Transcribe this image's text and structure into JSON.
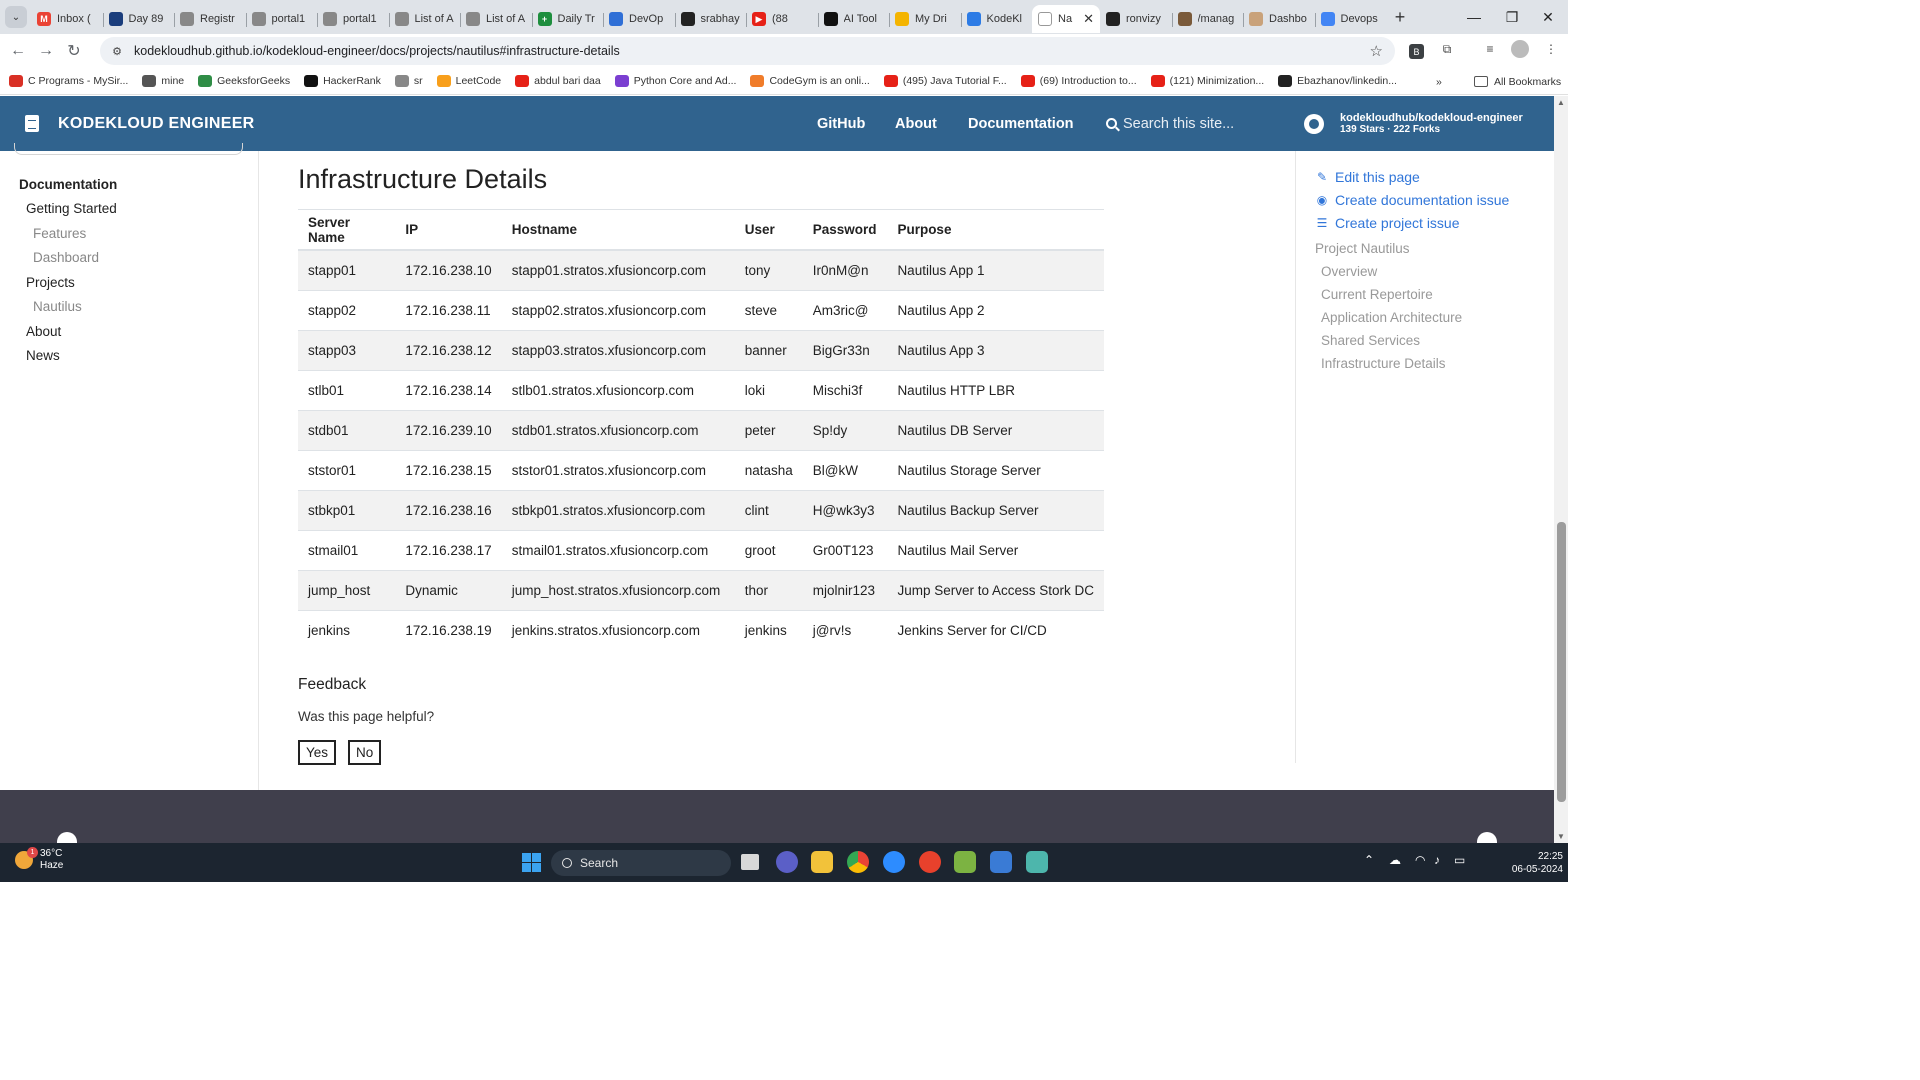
{
  "browser": {
    "tabs": [
      {
        "label": "Inbox (",
        "fav": "gmail-icon",
        "color": "#ea4335",
        "glyph": "M"
      },
      {
        "label": "Day 89",
        "fav": "page-icon",
        "color": "#1a3d7c",
        "glyph": ""
      },
      {
        "label": "Registr",
        "fav": "loading-icon",
        "color": "#888888",
        "glyph": ""
      },
      {
        "label": "portal1",
        "fav": "loading-icon",
        "color": "#888888",
        "glyph": ""
      },
      {
        "label": "portal1",
        "fav": "loading-icon",
        "color": "#888888",
        "glyph": ""
      },
      {
        "label": "List of A",
        "fav": "loading-icon",
        "color": "#888888",
        "glyph": ""
      },
      {
        "label": "List of A",
        "fav": "loading-icon",
        "color": "#888888",
        "glyph": ""
      },
      {
        "label": "Daily Tr",
        "fav": "sheets-icon",
        "color": "#1e8e3e",
        "glyph": "+"
      },
      {
        "label": "DevOp",
        "fav": "devops-icon",
        "color": "#2f6fd6",
        "glyph": ""
      },
      {
        "label": "srabhay",
        "fav": "github-icon",
        "color": "#222222",
        "glyph": ""
      },
      {
        "label": "(88",
        "fav": "youtube-icon",
        "color": "#e62117",
        "glyph": "▶"
      },
      {
        "label": "AI Tool",
        "fav": "ai-tool-icon",
        "color": "#111111",
        "glyph": ""
      },
      {
        "label": "My Dri",
        "fav": "drive-icon",
        "color": "#f4b400",
        "glyph": ""
      },
      {
        "label": "KodeKl",
        "fav": "kodekloud-icon",
        "color": "#2c7be5",
        "glyph": ""
      },
      {
        "label": "Na",
        "fav": "page-icon",
        "color": "#ffffff",
        "glyph": "",
        "active": true
      },
      {
        "label": "ronvizy",
        "fav": "github-icon",
        "color": "#222222",
        "glyph": ""
      },
      {
        "label": "/manag",
        "fav": "image-icon",
        "color": "#7a5a3a",
        "glyph": ""
      },
      {
        "label": "Dashbo",
        "fav": "avatar-icon",
        "color": "#c9a27a",
        "glyph": ""
      },
      {
        "label": "Devops",
        "fav": "docs-icon",
        "color": "#4285f4",
        "glyph": ""
      }
    ],
    "url": "kodekloudhub.github.io/kodekloud-engineer/docs/projects/nautilus#infrastructure-details",
    "bookmarks": [
      {
        "label": "C Programs - MySir...",
        "fav": "mysirg-icon",
        "color": "#d93025"
      },
      {
        "label": "mine",
        "fav": "folder-icon",
        "color": "#555555"
      },
      {
        "label": "GeeksforGeeks",
        "fav": "gfg-icon",
        "color": "#2f8d46"
      },
      {
        "label": "HackerRank",
        "fav": "hackerrank-icon",
        "color": "#111111"
      },
      {
        "label": "sr",
        "fav": "sr-icon",
        "color": "#888888"
      },
      {
        "label": "LeetCode",
        "fav": "leetcode-icon",
        "color": "#f89f1b"
      },
      {
        "label": "abdul bari daa",
        "fav": "youtube-icon",
        "color": "#e62117"
      },
      {
        "label": "Python Core and Ad...",
        "fav": "python-icon",
        "color": "#7b3fd1"
      },
      {
        "label": "CodeGym is an onli...",
        "fav": "codegym-icon",
        "color": "#f07c2a"
      },
      {
        "label": "(495) Java Tutorial F...",
        "fav": "youtube-icon",
        "color": "#e62117"
      },
      {
        "label": "(69) Introduction to...",
        "fav": "youtube-icon",
        "color": "#e62117"
      },
      {
        "label": "(121) Minimization...",
        "fav": "youtube-icon",
        "color": "#e62117"
      },
      {
        "label": "Ebazhanov/linkedin...",
        "fav": "github-icon",
        "color": "#222222"
      }
    ],
    "all_bookmarks": "All Bookmarks",
    "more_bookmarks": "»"
  },
  "site": {
    "brand": "KODEKLOUD ENGINEER",
    "nav": [
      "GitHub",
      "About",
      "Documentation"
    ],
    "search_placeholder": "Search this site...",
    "repo_name": "kodekloudhub/kodekloud-engineer",
    "repo_stats": "139 Stars · 222 Forks"
  },
  "sidebar": {
    "heading": "Documentation",
    "items": [
      {
        "label": "Getting Started",
        "level": 1
      },
      {
        "label": "Features",
        "level": 2
      },
      {
        "label": "Dashboard",
        "level": 2
      },
      {
        "label": "Projects",
        "level": 1
      },
      {
        "label": "Nautilus",
        "level": 2
      },
      {
        "label": "About",
        "level": 1
      },
      {
        "label": "News",
        "level": 1
      }
    ]
  },
  "main": {
    "title": "Infrastructure Details",
    "columns": [
      "Server Name",
      "IP",
      "Hostname",
      "User",
      "Password",
      "Purpose"
    ],
    "rows": [
      [
        "stapp01",
        "172.16.238.10",
        "stapp01.stratos.xfusioncorp.com",
        "tony",
        "Ir0nM@n",
        "Nautilus App 1"
      ],
      [
        "stapp02",
        "172.16.238.11",
        "stapp02.stratos.xfusioncorp.com",
        "steve",
        "Am3ric@",
        "Nautilus App 2"
      ],
      [
        "stapp03",
        "172.16.238.12",
        "stapp03.stratos.xfusioncorp.com",
        "banner",
        "BigGr33n",
        "Nautilus App 3"
      ],
      [
        "stlb01",
        "172.16.238.14",
        "stlb01.stratos.xfusioncorp.com",
        "loki",
        "Mischi3f",
        "Nautilus HTTP LBR"
      ],
      [
        "stdb01",
        "172.16.239.10",
        "stdb01.stratos.xfusioncorp.com",
        "peter",
        "Sp!dy",
        "Nautilus DB Server"
      ],
      [
        "ststor01",
        "172.16.238.15",
        "ststor01.stratos.xfusioncorp.com",
        "natasha",
        "Bl@kW",
        "Nautilus Storage Server"
      ],
      [
        "stbkp01",
        "172.16.238.16",
        "stbkp01.stratos.xfusioncorp.com",
        "clint",
        "H@wk3y3",
        "Nautilus Backup Server"
      ],
      [
        "stmail01",
        "172.16.238.17",
        "stmail01.stratos.xfusioncorp.com",
        "groot",
        "Gr00T123",
        "Nautilus Mail Server"
      ],
      [
        "jump_host",
        "Dynamic",
        "jump_host.stratos.xfusioncorp.com",
        "thor",
        "mjolnir123",
        "Jump Server to Access Stork DC"
      ],
      [
        "jenkins",
        "172.16.238.19",
        "jenkins.stratos.xfusioncorp.com",
        "jenkins",
        "j@rv!s",
        "Jenkins Server for CI/CD"
      ]
    ],
    "feedback": {
      "title": "Feedback",
      "question": "Was this page helpful?",
      "yes": "Yes",
      "no": "No"
    }
  },
  "toc": {
    "links": [
      {
        "label": "Edit this page",
        "icon": "edit-icon"
      },
      {
        "label": "Create documentation issue",
        "icon": "github-icon"
      },
      {
        "label": "Create project issue",
        "icon": "tasks-icon"
      }
    ],
    "heading": "Project Nautilus",
    "items": [
      "Overview",
      "Current Repertoire",
      "Application Architecture",
      "Shared Services",
      "Infrastructure Details"
    ]
  },
  "taskbar": {
    "temperature": "36°C",
    "weather": "Haze",
    "search": "Search",
    "notification_count": "1",
    "time": "22:25",
    "date": "06-05-2024"
  },
  "colors": {
    "header": "#30638e",
    "footer": "#403f4c",
    "link": "#3176d9",
    "taskbar": "#1c2530"
  }
}
